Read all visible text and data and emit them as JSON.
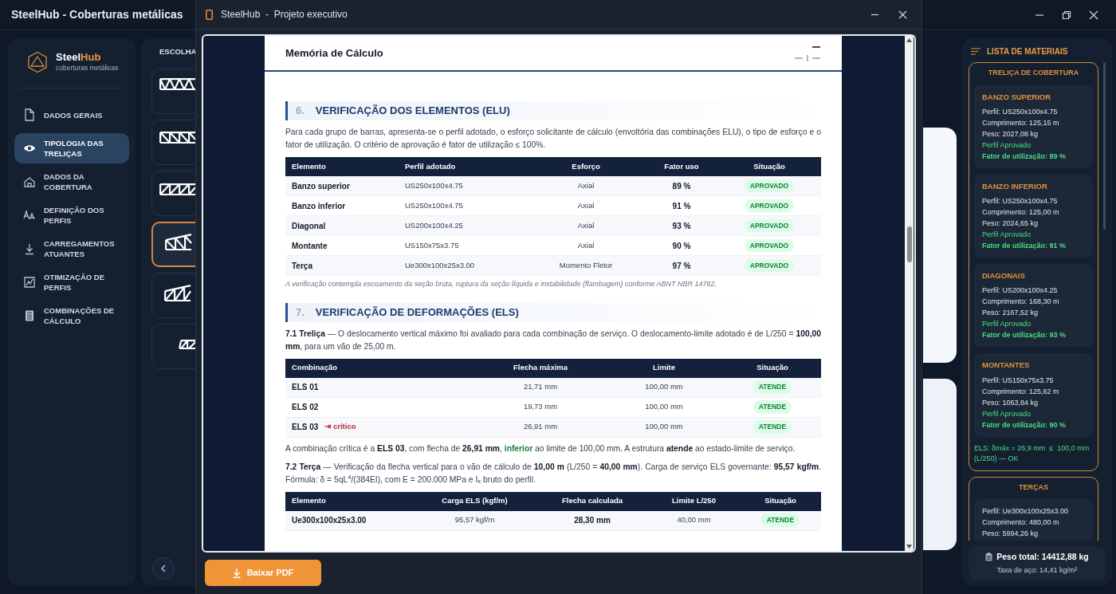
{
  "window": {
    "title": "SteelHub - Coberturas metálicas"
  },
  "sidebar": {
    "brand": {
      "name_first": "Steel",
      "name_second": "Hub",
      "tagline": "coberturas metálicas"
    },
    "items": [
      {
        "label": "DADOS GERAIS",
        "selected": false
      },
      {
        "label": "TIPOLOGIA DAS TRELIÇAS",
        "selected": true
      },
      {
        "label": "DADOS DA COBERTURA",
        "selected": false
      },
      {
        "label": "DEFINIÇÃO DOS PERFIS",
        "selected": false
      },
      {
        "label": "CARREGAMENTOS ATUANTES",
        "selected": false
      },
      {
        "label": "OTIMIZAÇÃO DE PERFIS",
        "selected": false
      },
      {
        "label": "COMBINAÇÕES DE CÁLCULO",
        "selected": false
      }
    ]
  },
  "truss_panel": {
    "heading": "ESCOLHA",
    "options": [
      {
        "kind": "warren",
        "selected": false
      },
      {
        "kind": "pratt",
        "selected": false
      },
      {
        "kind": "howe",
        "selected": false
      },
      {
        "kind": "pratt-sloped",
        "selected": true
      },
      {
        "kind": "howe-sloped",
        "selected": false
      },
      {
        "kind": "small",
        "selected": false
      }
    ]
  },
  "modal": {
    "title_app": "SteelHub",
    "title_separator": "-",
    "title_doc": "Projeto executivo",
    "document": {
      "heading": "Memória de Cálculo",
      "sections": [
        {
          "number": "6.",
          "title": "VERIFICAÇÃO DOS ELEMENTOS (ELU)",
          "blocks": [
            {
              "kind": "paragraph",
              "text": "Para cada grupo de barras, apresenta-se o perfil adotado, o esforço solicitante de cálculo (envoltória das combinações ELU), o tipo de esforço e o fator de utilização. O critério de aprovação é fator de utilização ≤ 100%."
            },
            {
              "kind": "table",
              "columns": [
                {
                  "label": "Elemento",
                  "kind": "name"
                },
                {
                  "label": "Perfil adotado",
                  "kind": "text"
                },
                {
                  "label": "Esforço",
                  "kind": "center"
                },
                {
                  "label": "Fator uso",
                  "kind": "strong"
                },
                {
                  "label": "Situação",
                  "kind": "badge"
                }
              ],
              "rows": [
                {
                  "cells": [
                    "Banzo superior",
                    "US250x100x4.75",
                    "Axial",
                    "89 %",
                    "APROVADO"
                  ]
                },
                {
                  "cells": [
                    "Banzo inferior",
                    "US250x100x4.75",
                    "Axial",
                    "91 %",
                    "APROVADO"
                  ]
                },
                {
                  "cells": [
                    "Diagonal",
                    "US200x100x4.25",
                    "Axial",
                    "93 %",
                    "APROVADO"
                  ]
                },
                {
                  "cells": [
                    "Montante",
                    "US150x75x3.75",
                    "Axial",
                    "90 %",
                    "APROVADO"
                  ]
                },
                {
                  "cells": [
                    "Terça",
                    "Ue300x100x25x3.00",
                    "Momento Fletor",
                    "97 %",
                    "APROVADO"
                  ]
                }
              ]
            },
            {
              "kind": "note",
              "text": "A verificação contempla escoamento da seção bruta, ruptura da seção líquida e instabilidade (flambagem) conforme ABNT NBR 14762."
            }
          ]
        },
        {
          "number": "7.",
          "title": "VERIFICAÇÃO DE DEFORMAÇÕES (ELS)",
          "blocks": [
            {
              "kind": "paragraph",
              "text": "**7.1 Treliça** — O deslocamento vertical máximo foi avaliado para cada combinação de serviço. O deslocamento-limite adotado é de L/250 = **100,00 mm**, para um vão de 25,00 m."
            },
            {
              "kind": "table",
              "columns": [
                {
                  "label": "Combinação",
                  "kind": "name"
                },
                {
                  "label": "Flecha máxima",
                  "kind": "center"
                },
                {
                  "label": "Limite",
                  "kind": "center"
                },
                {
                  "label": "Situação",
                  "kind": "badge"
                }
              ],
              "rows": [
                {
                  "cells": [
                    "ELS 01",
                    "21,71 mm",
                    "100,00 mm",
                    "ATENDE"
                  ]
                },
                {
                  "cells": [
                    "ELS 02",
                    "19,73 mm",
                    "100,00 mm",
                    "ATENDE"
                  ]
                },
                {
                  "cells": [
                    "ELS 03",
                    "26,91 mm",
                    "100,00 mm",
                    "ATENDE"
                  ],
                  "flag": "⇥ crítico"
                }
              ]
            },
            {
              "kind": "paragraph",
              "parts": [
                {
                  "text": "A combinação crítica é a **ELS 03**, com flecha de **26,91 mm**, ",
                  "emphasis": false
                },
                {
                  "text": "inferior",
                  "emphasis": true
                },
                {
                  "text": " ao limite de 100,00 mm. A estrutura **atende** ao estado-limite de serviço.",
                  "emphasis": false
                }
              ]
            },
            {
              "kind": "paragraph",
              "text": "**7.2 Terça** — Verificação da flecha vertical para o vão de cálculo de **10,00 m** (L/250 = **40,00 mm**). Carga de serviço ELS governante: **95,57 kgf/m**. Fórmula: δ = 5qL$^{4}$/(384EI), com E = 200.000 MPa e I$_{x}$ bruto do perfil."
            },
            {
              "kind": "table",
              "columns": [
                {
                  "label": "Elemento",
                  "kind": "name"
                },
                {
                  "label": "Carga ELS (kgf/m)",
                  "kind": "center"
                },
                {
                  "label": "Flecha calculada",
                  "kind": "strong"
                },
                {
                  "label": "Limite L/250",
                  "kind": "center"
                },
                {
                  "label": "Situação",
                  "kind": "badge"
                }
              ],
              "rows": [
                {
                  "cells": [
                    "Ue300x100x25x3.00",
                    "95,57 kgf/m",
                    "28,30 mm",
                    "40,00 mm",
                    "ATENDE"
                  ]
                }
              ]
            }
          ]
        }
      ]
    },
    "download_button": "Baixar PDF"
  },
  "materials": {
    "heading": "LISTA DE MATERIAIS",
    "groups": [
      {
        "title": "TRELIÇA DE COBERTURA",
        "items": [
          {
            "name": "BANZO SUPERIOR",
            "lines": [
              "Perfil: US250x100x4.75",
              "Comprimento: 125,15 m",
              "Peso: 2027,08 kg"
            ],
            "status": "Perfil Aprovado",
            "utilization": "Fator de utilização: 89 %"
          },
          {
            "name": "BANZO INFERIOR",
            "lines": [
              "Perfil: US250x100x4.75",
              "Comprimento: 125,00 m",
              "Peso: 2024,65 kg"
            ],
            "status": "Perfil Aprovado",
            "utilization": "Fator de utilização: 91 %"
          },
          {
            "name": "DIAGONAIS",
            "lines": [
              "Perfil: US200x100x4.25",
              "Comprimento: 168,30 m",
              "Peso: 2167,52 kg"
            ],
            "status": "Perfil Aprovado",
            "utilization": "Fator de utilização: 93 %"
          },
          {
            "name": "MONTANTES",
            "lines": [
              "Perfil: US150x75x3.75",
              "Comprimento: 125,62 m",
              "Peso: 1063,84 kg"
            ],
            "status": "Perfil Aprovado",
            "utilization": "Fator de utilização: 90 %"
          }
        ],
        "footer": "ELS: δmáx = 26,9 mm  ≤  100,0 mm (L/250) — OK"
      },
      {
        "title": "TERÇAS",
        "items": [
          {
            "lines": [
              "Perfil: Ue300x100x25x3.00",
              "Comprimento: 480,00 m",
              "Peso: 5994,26 kg"
            ]
          }
        ]
      }
    ],
    "total": "Peso total: 14412,88 kg",
    "rate": "Taxa de aço: 14,41 kg/m²"
  }
}
